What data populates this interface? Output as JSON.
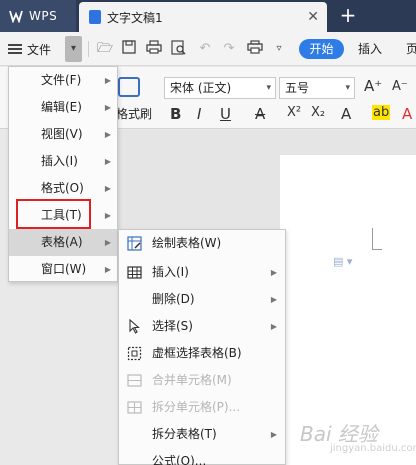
{
  "titlebar": {
    "app_name": "WPS",
    "doc_title": "文字文稿1",
    "close_glyph": "✕",
    "new_tab_glyph": "+"
  },
  "menubar": {
    "file_label": "文件",
    "start_label": "开始",
    "insert_label": "插入",
    "page_label": "页"
  },
  "ribbon": {
    "format_brush": "格式刷",
    "font_name": "宋体 (正文)",
    "font_size": "五号",
    "grow": "A⁺",
    "shrink": "A⁻",
    "bold": "B",
    "italic": "I",
    "underline": "U",
    "strike": "A",
    "superscript": "X²",
    "subscript": "X₂",
    "effects": "A",
    "highlight": "ab",
    "color": "A"
  },
  "file_menu": {
    "items": [
      {
        "label": "文件(F)"
      },
      {
        "label": "编辑(E)"
      },
      {
        "label": "视图(V)"
      },
      {
        "label": "插入(I)"
      },
      {
        "label": "格式(O)"
      },
      {
        "label": "工具(T)"
      },
      {
        "label": "表格(A)"
      },
      {
        "label": "窗口(W)"
      }
    ]
  },
  "table_submenu": {
    "items": [
      {
        "label": "绘制表格(W)",
        "enabled": true
      },
      {
        "label": "插入(I)",
        "enabled": true
      },
      {
        "label": "删除(D)",
        "enabled": true
      },
      {
        "label": "选择(S)",
        "enabled": true
      },
      {
        "label": "虚框选择表格(B)",
        "enabled": true
      },
      {
        "label": "合并单元格(M)",
        "enabled": false
      },
      {
        "label": "拆分单元格(P)...",
        "enabled": false
      },
      {
        "label": "拆分表格(T)",
        "enabled": true
      },
      {
        "label": "公式(O)...",
        "enabled": true
      }
    ]
  },
  "watermark": {
    "text": "Bai 经验",
    "sub": "jingyan.baidu.com"
  },
  "colors": {
    "titlebar": "#2c3a55",
    "accent": "#2e7ce6",
    "highlight_box": "#e02020"
  }
}
